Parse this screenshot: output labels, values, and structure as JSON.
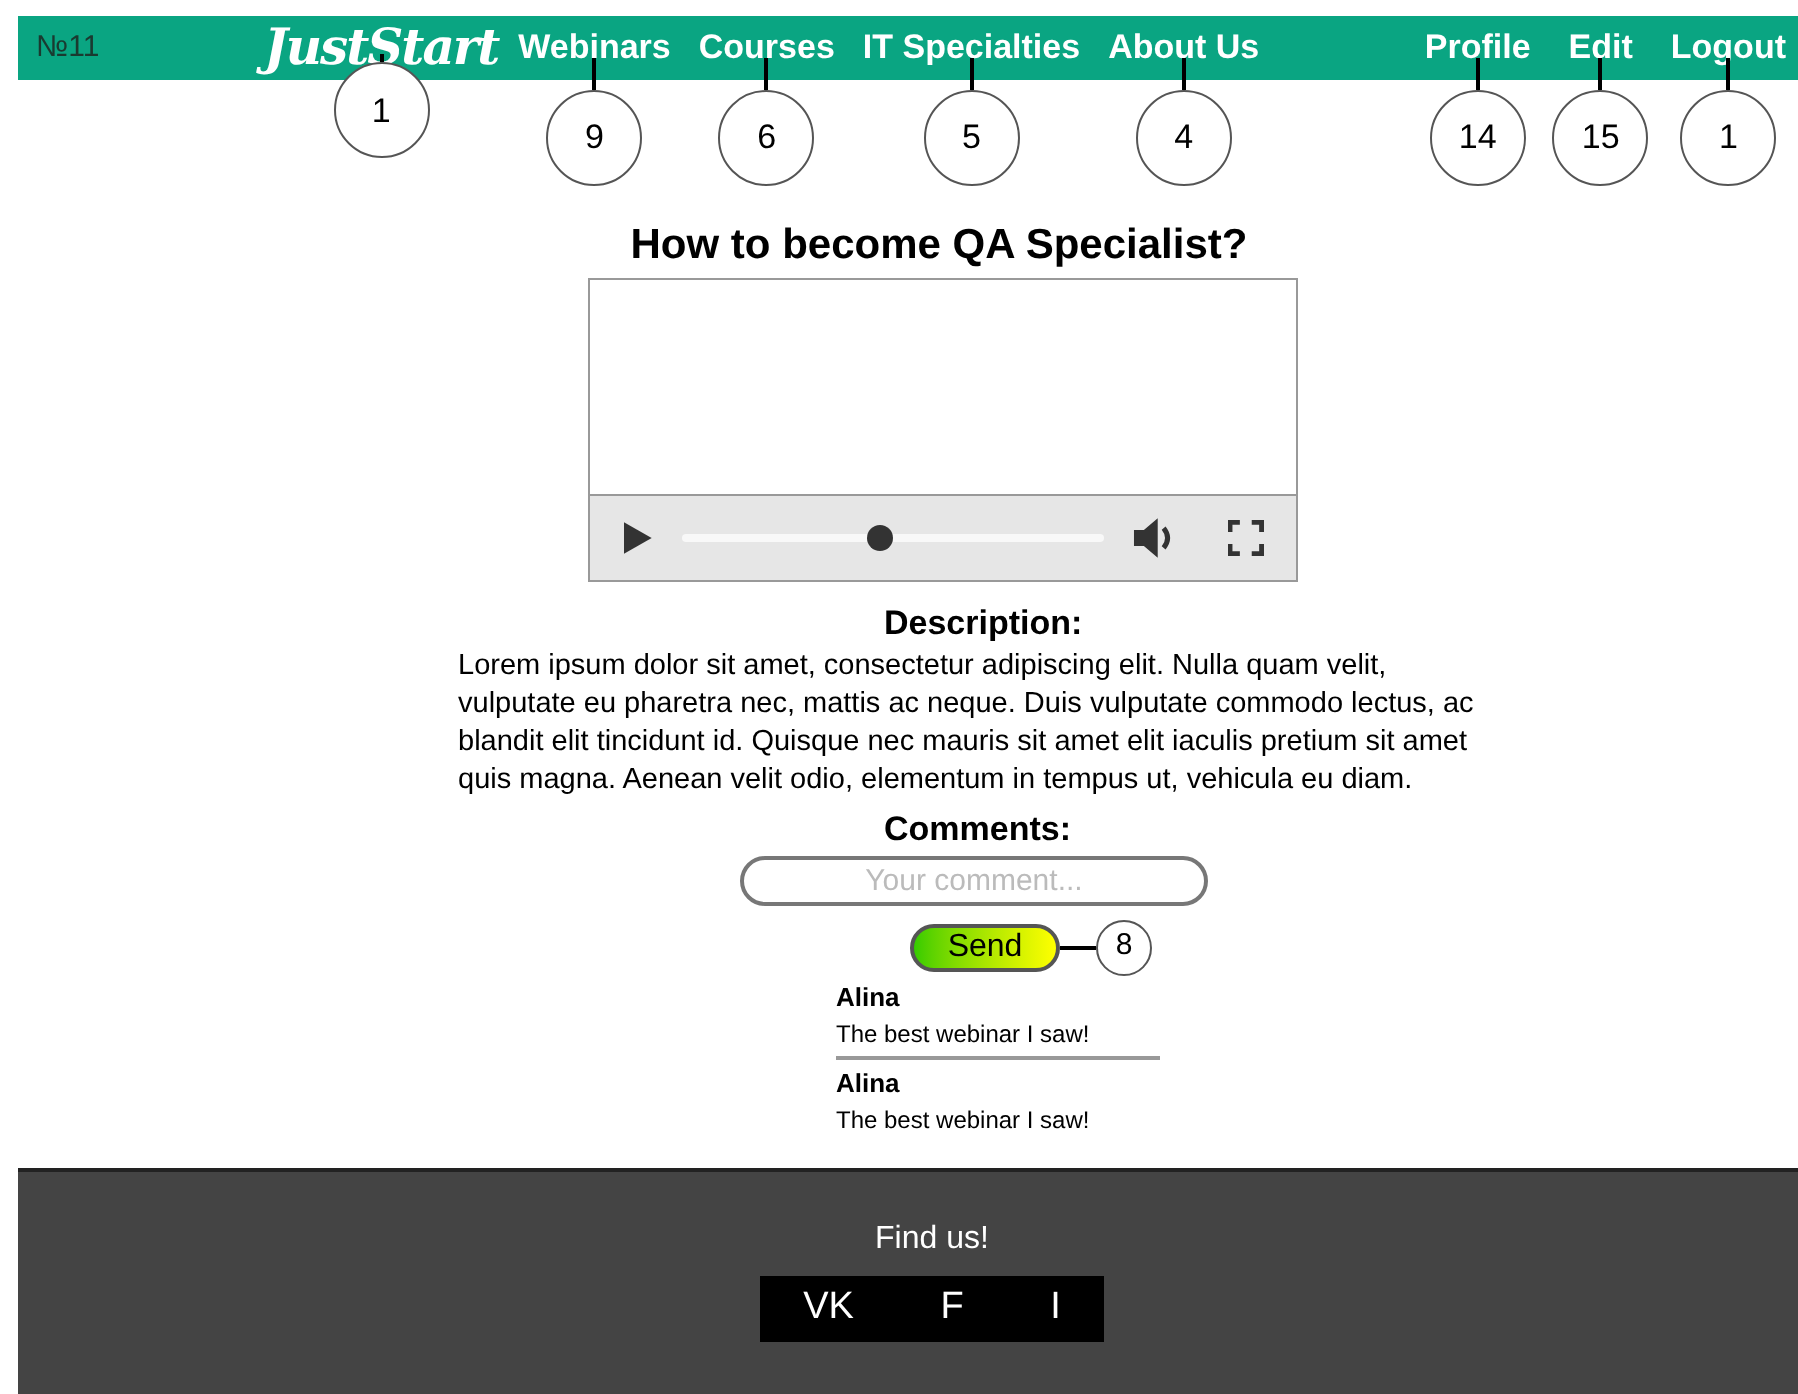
{
  "page_number": "№11",
  "logo": {
    "text": "JustStart",
    "callout": "1"
  },
  "nav": [
    {
      "label": "Webinars",
      "callout": "9"
    },
    {
      "label": "Courses",
      "callout": "6"
    },
    {
      "label": "IT Specialties",
      "callout": "5"
    },
    {
      "label": "About Us",
      "callout": "4"
    }
  ],
  "user_nav": [
    {
      "label": "Profile",
      "callout": "14"
    },
    {
      "label": "Edit",
      "callout": "15"
    },
    {
      "label": "Logout",
      "callout": "1"
    }
  ],
  "title": "How to become QA Specialist?",
  "video": {
    "progress": {
      "level": 0.47
    }
  },
  "description": {
    "heading": "Description:",
    "text": "Lorem ipsum dolor sit amet, consectetur adipiscing elit. Nulla quam velit, vulputate eu pharetra nec, mattis ac neque. Duis vulputate commodo lectus, ac blandit elit tincidunt id. Quisque nec mauris sit amet elit iaculis pretium sit amet quis magna. Aenean velit odio, elementum in tempus ut, vehicula eu diam."
  },
  "comments": {
    "heading": "Comments:",
    "placeholder": "Your comment...",
    "send": {
      "label": "Send",
      "callout": "8"
    },
    "items": [
      {
        "author": "Alina",
        "text": "The best webinar I saw!"
      },
      {
        "author": "Alina",
        "text": "The best webinar I saw!"
      }
    ]
  },
  "footer": {
    "heading": "Find us!",
    "links": [
      "VK",
      "F",
      "I"
    ]
  }
}
